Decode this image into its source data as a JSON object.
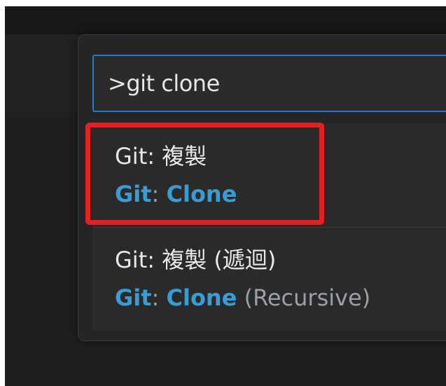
{
  "command_palette": {
    "query": ">git clone",
    "results": [
      {
        "localized_label": "Git: 複製",
        "english_prefix": "Git",
        "english_colon": ":",
        "english_command": "Clone",
        "english_suffix": ""
      },
      {
        "localized_label": "Git: 複製 (遞迴)",
        "english_prefix": "Git",
        "english_colon": ":",
        "english_command": "Clone",
        "english_suffix": " (Recursive)"
      }
    ]
  },
  "annotation": {
    "highlight_color": "#e42121"
  },
  "colors": {
    "accent": "#1a7fd4",
    "match_highlight": "#3a9bd5"
  }
}
